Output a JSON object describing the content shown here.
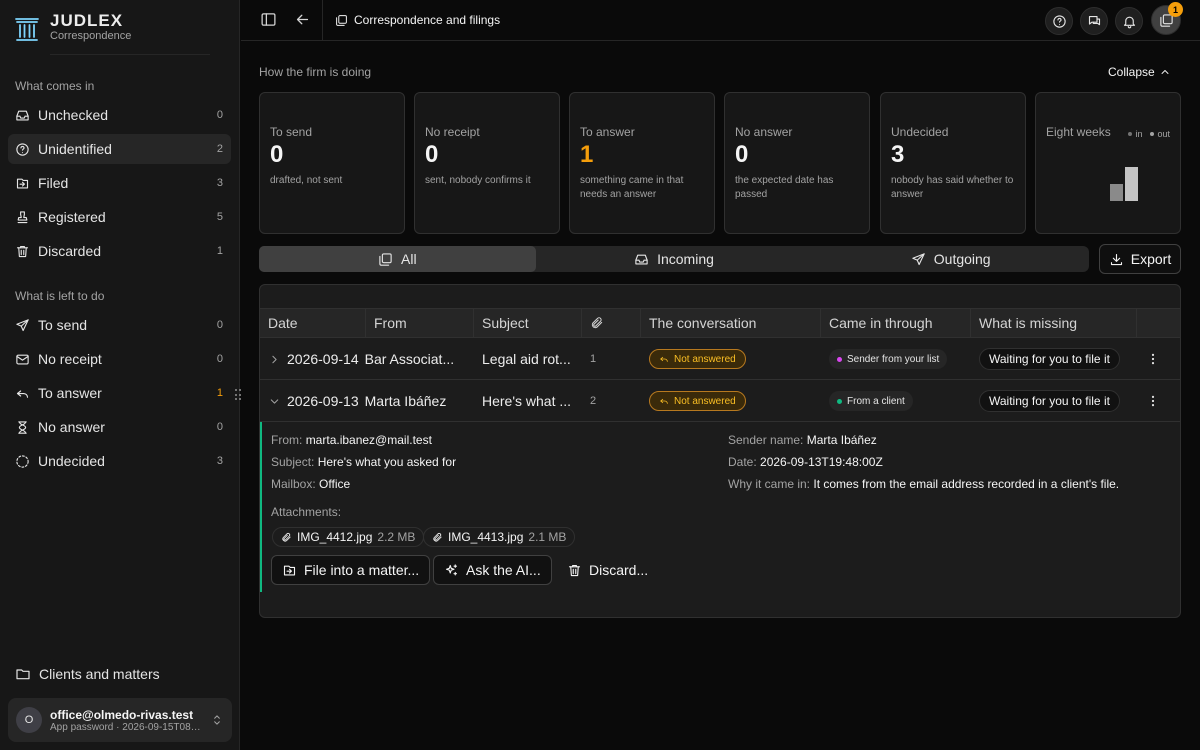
{
  "brand": {
    "name": "JUDLEX",
    "subtitle": "Correspondence"
  },
  "sidebar": {
    "incoming_label": "What comes in",
    "incoming": [
      {
        "label": "Unchecked",
        "count": "0",
        "icon": "inbox-icon"
      },
      {
        "label": "Unidentified",
        "count": "2",
        "icon": "question-circle-icon",
        "active": true
      },
      {
        "label": "Filed",
        "count": "3",
        "icon": "file-in-icon"
      },
      {
        "label": "Registered",
        "count": "5",
        "icon": "stamp-icon"
      },
      {
        "label": "Discarded",
        "count": "1",
        "icon": "trash-icon"
      }
    ],
    "todo_label": "What is left to do",
    "todo": [
      {
        "label": "To send",
        "count": "0",
        "icon": "send-icon"
      },
      {
        "label": "No receipt",
        "count": "0",
        "icon": "mail-icon"
      },
      {
        "label": "To answer",
        "count": "1",
        "icon": "reply-icon",
        "warn": true
      },
      {
        "label": "No answer",
        "count": "0",
        "icon": "hourglass-icon"
      },
      {
        "label": "Undecided",
        "count": "3",
        "icon": "dashed-circle-icon"
      }
    ],
    "clients_label": "Clients and matters",
    "account": {
      "avatar": "O",
      "email": "office@olmedo-rivas.test",
      "sub": "App password · 2026-09-15T08…"
    }
  },
  "topbar": {
    "breadcrumb": "Correspondence and filings",
    "notifications": "1"
  },
  "overview": {
    "title": "How the firm is doing",
    "collapse_label": "Collapse",
    "cards": [
      {
        "label": "To send",
        "value": "0",
        "desc": "drafted, not sent"
      },
      {
        "label": "No receipt",
        "value": "0",
        "desc": "sent, nobody confirms it"
      },
      {
        "label": "To answer",
        "value": "1",
        "desc": "something came in that needs an answer",
        "warn": true
      },
      {
        "label": "No answer",
        "value": "0",
        "desc": "the expected date has passed"
      },
      {
        "label": "Undecided",
        "value": "3",
        "desc": "nobody has said whether to answer"
      }
    ],
    "weeks": {
      "label": "Eight weeks",
      "in_label": "in",
      "out_label": "out",
      "in_value": 1,
      "out_value": 2
    },
    "colors": {
      "in": "#737373",
      "out": "#a3a3a3",
      "warn": "#f59e0b"
    }
  },
  "tabs": [
    {
      "label": "All",
      "icon": "stack-icon",
      "active": true
    },
    {
      "label": "Incoming",
      "icon": "inbox-icon"
    },
    {
      "label": "Outgoing",
      "icon": "send-icon"
    }
  ],
  "export_label": "Export",
  "table": {
    "columns": [
      "Date",
      "From",
      "Subject",
      "",
      "The conversation",
      "Came in through",
      "What is missing"
    ],
    "rows": [
      {
        "date": "2026-09-14",
        "from": "Bar Associat...",
        "subject": "Legal aid rot...",
        "attachments": "1",
        "status": "Not answered",
        "source": "Sender from your list",
        "source_color": "#d946ef",
        "missing": "Waiting for you to file it",
        "expanded": false
      },
      {
        "date": "2026-09-13",
        "from": "Marta Ibáñez",
        "subject": "Here's what ...",
        "attachments": "2",
        "status": "Not answered",
        "source": "From a client",
        "source_color": "#10b981",
        "missing": "Waiting for you to file it",
        "expanded": true
      }
    ]
  },
  "detail": {
    "from_label": "From:",
    "from": "marta.ibanez@mail.test",
    "subject_label": "Subject:",
    "subject": "Here's what you asked for",
    "mailbox_label": "Mailbox:",
    "mailbox": "Office",
    "sender_label": "Sender name:",
    "sender": "Marta Ibáñez",
    "date_label": "Date:",
    "date": "2026-09-13T19:48:00Z",
    "why_label": "Why it came in:",
    "why": "It comes from the email address recorded in a client's file.",
    "attachments_label": "Attachments:",
    "attachments": [
      {
        "name": "IMG_4412.jpg",
        "size": "2.2 MB"
      },
      {
        "name": "IMG_4413.jpg",
        "size": "2.1 MB"
      }
    ],
    "actions": {
      "file": "File into a matter...",
      "ai": "Ask the AI...",
      "discard": "Discard..."
    }
  }
}
